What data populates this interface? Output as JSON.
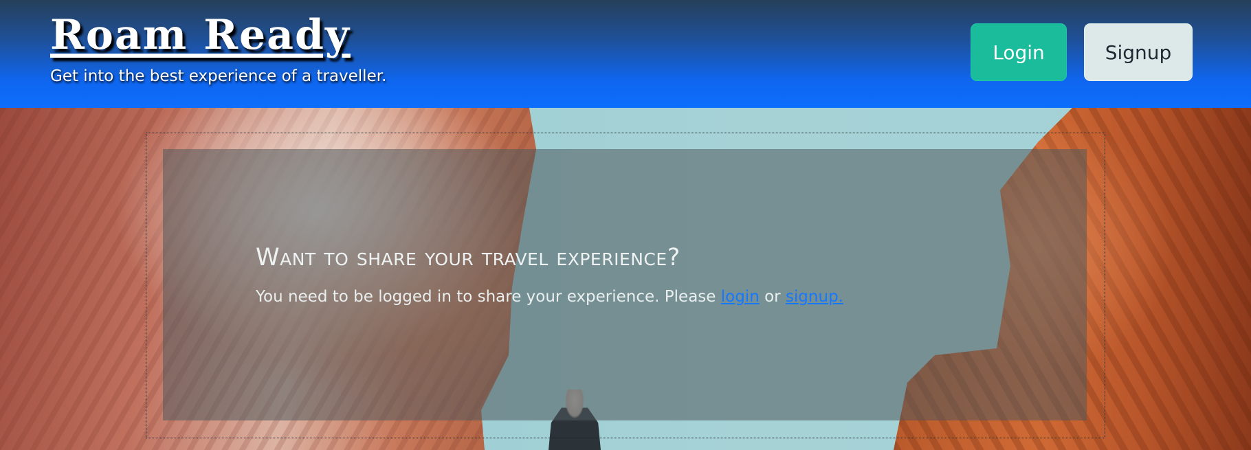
{
  "header": {
    "brand": "Roam Ready",
    "tagline": "Get into the best experience of a traveller.",
    "login_label": "Login",
    "signup_label": "Signup",
    "colors": {
      "login_bg": "#1abc9c",
      "signup_bg": "#dde9e9",
      "header_bg": "#0d6efd"
    }
  },
  "main": {
    "title": "Want to share your travel experience?",
    "message_prefix": "You need to be logged in to share your experience. Please ",
    "login_link": "login",
    "separator": " or ",
    "signup_link": "signup.",
    "link_color": "#1677ff"
  }
}
